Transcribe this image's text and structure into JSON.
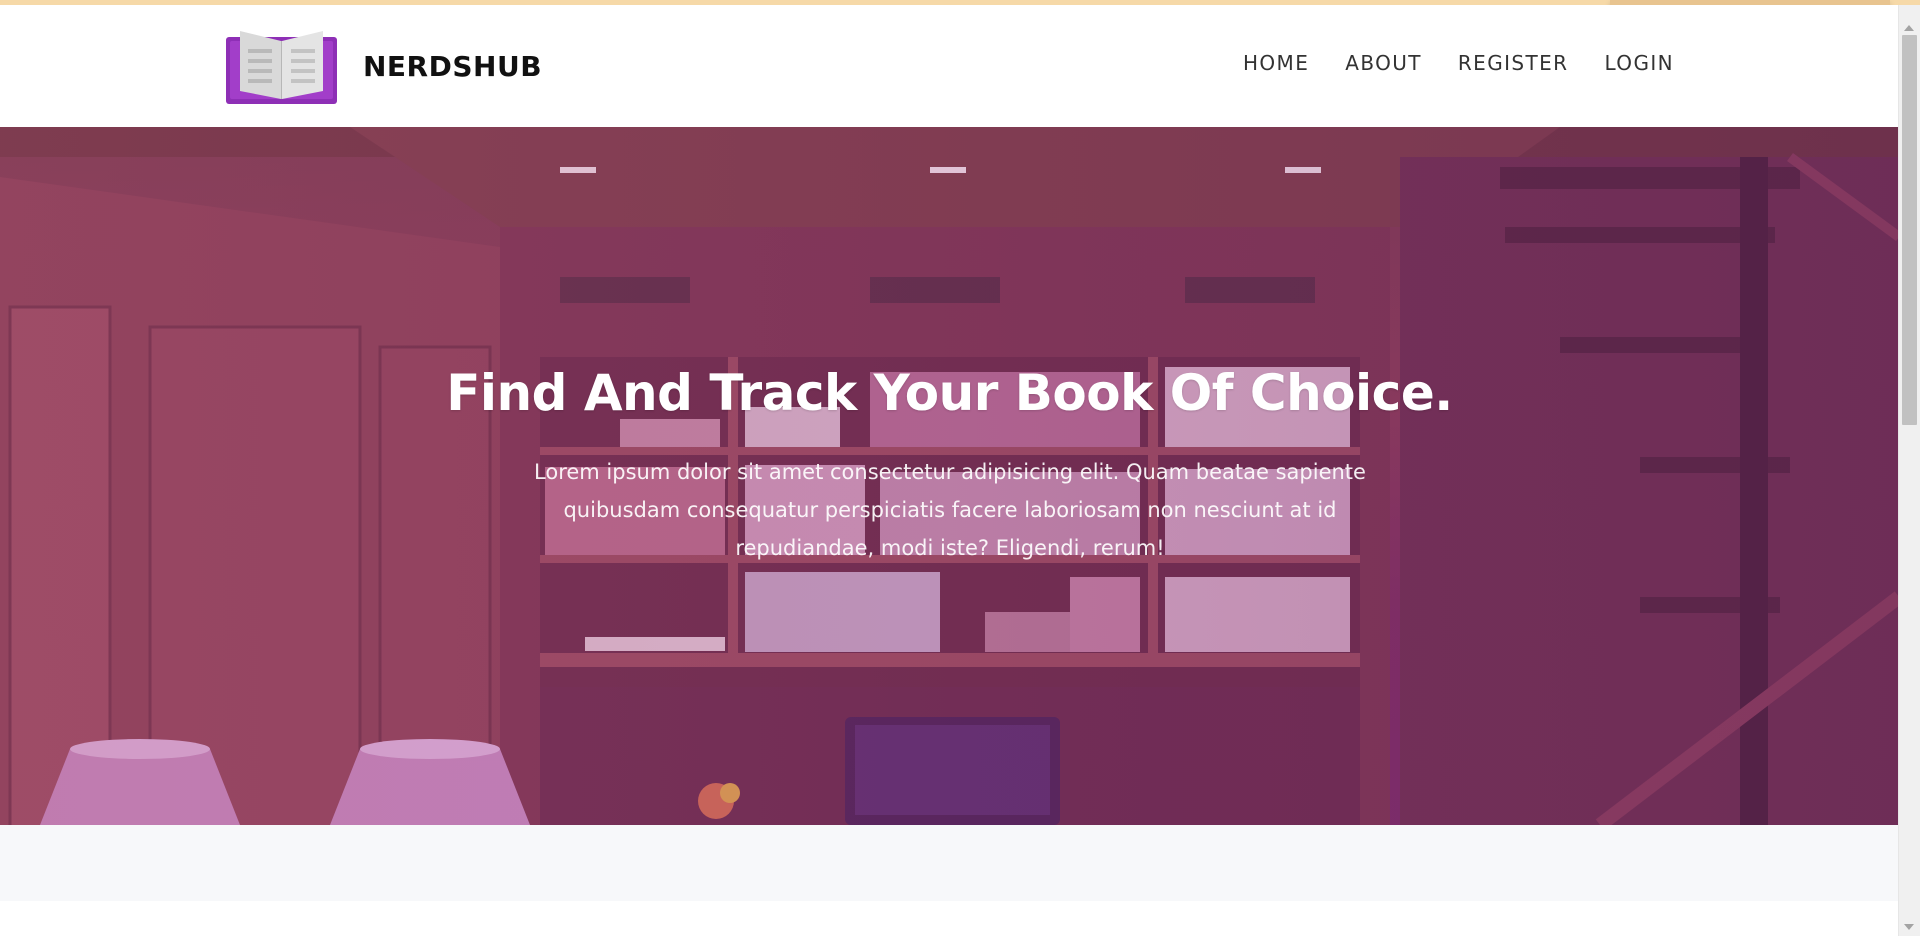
{
  "navbar": {
    "brand_name": "NERDSHUB",
    "logo_icon": "open-book-icon",
    "links": [
      "HOME",
      "ABOUT",
      "REGISTER",
      "LOGIN"
    ]
  },
  "hero": {
    "title": "Find And Track Your Book Of Choice.",
    "text": "Lorem ipsum dolor sit amet consectetur adipisicing elit. Quam beatae sapiente quibusdam consequatur perspiciatis facere laboriosam non nesciunt at id repudiandae, modi iste? Eligendi, rerum!",
    "background": "library-room-image"
  },
  "colors": {
    "brand_purple": "#8e2fb6",
    "hero_tint": "#8a3b6e",
    "nav_text": "#333333"
  }
}
